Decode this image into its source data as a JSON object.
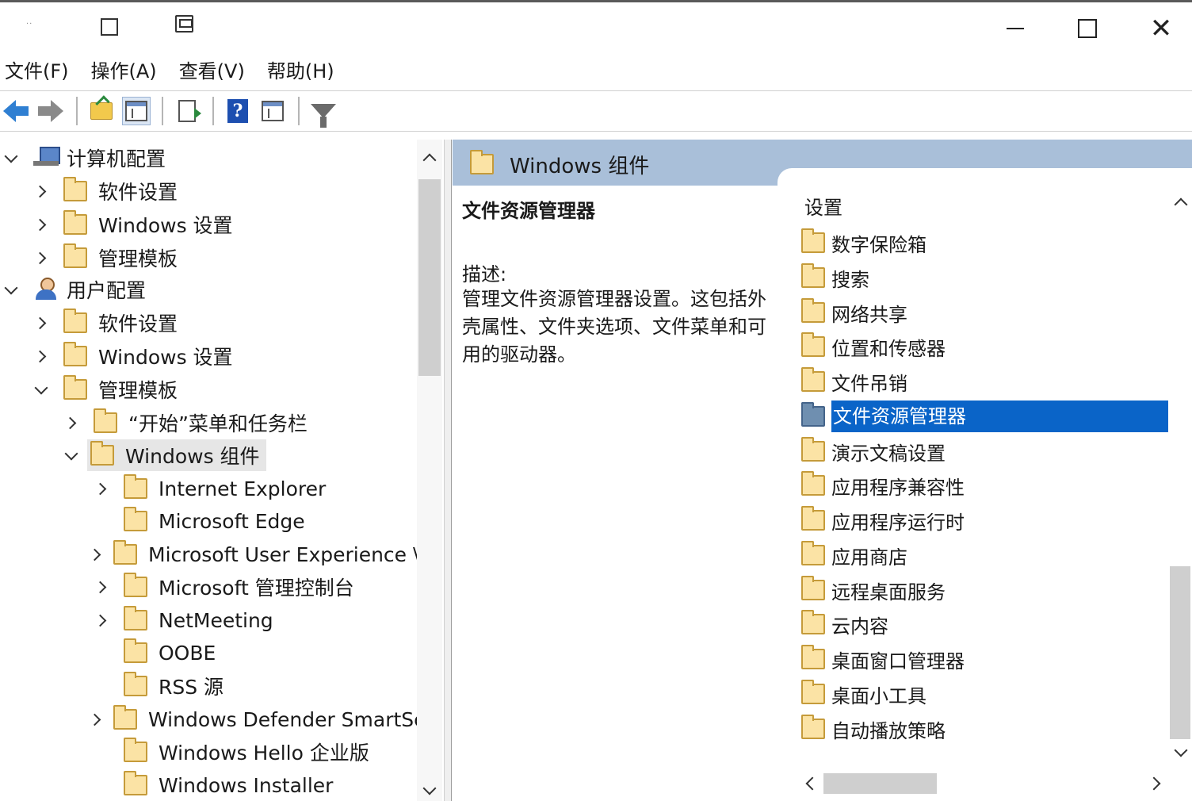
{
  "titlebar": {
    "controls": [
      "minimize",
      "maximize",
      "close"
    ]
  },
  "menu": [
    "文件(F)",
    "操作(A)",
    "查看(V)",
    "帮助(H)"
  ],
  "toolbar": {
    "buttons": [
      "back-arrow",
      "forward-arrow",
      "up-folder",
      "show-hide-console-tree",
      "export-list",
      "help",
      "show-action-pane",
      "filter"
    ]
  },
  "tree": {
    "items": [
      {
        "label": "计算机配置",
        "level": 0,
        "state": "expanded",
        "icon": "computer-icon"
      },
      {
        "label": "软件设置",
        "level": 1,
        "state": "collapsed",
        "icon": "folder-icon"
      },
      {
        "label": "Windows 设置",
        "level": 1,
        "state": "collapsed",
        "icon": "folder-icon"
      },
      {
        "label": "管理模板",
        "level": 1,
        "state": "collapsed",
        "icon": "folder-icon"
      },
      {
        "label": "用户配置",
        "level": 0,
        "state": "expanded",
        "icon": "user-icon"
      },
      {
        "label": "软件设置",
        "level": 1,
        "state": "collapsed",
        "icon": "folder-icon"
      },
      {
        "label": "Windows 设置",
        "level": 1,
        "state": "collapsed",
        "icon": "folder-icon"
      },
      {
        "label": "管理模板",
        "level": 1,
        "state": "expanded",
        "icon": "folder-icon"
      },
      {
        "label": "“开始”菜单和任务栏",
        "level": 2,
        "state": "collapsed",
        "icon": "folder-icon"
      },
      {
        "label": "Windows 组件",
        "level": 2,
        "state": "expanded",
        "icon": "folder-icon",
        "selected": true
      },
      {
        "label": "Internet Explorer",
        "level": 3,
        "state": "collapsed",
        "icon": "folder-icon"
      },
      {
        "label": "Microsoft Edge",
        "level": 3,
        "state": "leaf",
        "icon": "folder-icon"
      },
      {
        "label": "Microsoft User Experience \\",
        "level": 3,
        "state": "collapsed",
        "icon": "folder-icon"
      },
      {
        "label": "Microsoft 管理控制台",
        "level": 3,
        "state": "collapsed",
        "icon": "folder-icon"
      },
      {
        "label": "NetMeeting",
        "level": 3,
        "state": "collapsed",
        "icon": "folder-icon"
      },
      {
        "label": "OOBE",
        "level": 3,
        "state": "leaf",
        "icon": "folder-icon"
      },
      {
        "label": "RSS 源",
        "level": 3,
        "state": "leaf",
        "icon": "folder-icon"
      },
      {
        "label": "Windows Defender SmartSc",
        "level": 3,
        "state": "collapsed",
        "icon": "folder-icon"
      },
      {
        "label": "Windows Hello 企业版",
        "level": 3,
        "state": "leaf",
        "icon": "folder-icon"
      },
      {
        "label": "Windows Installer",
        "level": 3,
        "state": "leaf",
        "icon": "folder-icon"
      }
    ]
  },
  "right": {
    "header_title": "Windows 组件",
    "description": {
      "title": "文件资源管理器",
      "label": "描述:",
      "text": "管理文件资源管理器设置。这包括外壳属性、文件夹选项、文件菜单和可用的驱动器。"
    },
    "settings_header": "设置",
    "settings": [
      {
        "label": "数字保险箱"
      },
      {
        "label": "搜索"
      },
      {
        "label": "网络共享"
      },
      {
        "label": "位置和传感器"
      },
      {
        "label": "文件吊销"
      },
      {
        "label": "文件资源管理器",
        "selected": true
      },
      {
        "label": "演示文稿设置"
      },
      {
        "label": "应用程序兼容性"
      },
      {
        "label": "应用程序运行时"
      },
      {
        "label": "应用商店"
      },
      {
        "label": "远程桌面服务"
      },
      {
        "label": "云内容"
      },
      {
        "label": "桌面窗口管理器"
      },
      {
        "label": "桌面小工具"
      },
      {
        "label": "自动播放策略"
      }
    ]
  },
  "colors": {
    "selection": "#0a64c8",
    "header_band": "#a9bfd9",
    "tree_selection": "#e6e6e6",
    "folder": "#fbe3a5"
  }
}
